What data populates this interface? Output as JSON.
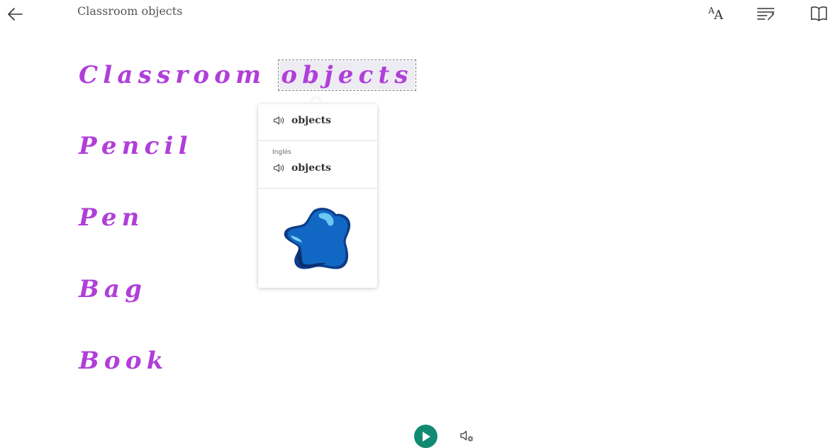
{
  "header": {
    "title": "Classroom objects",
    "icons": {
      "back": "arrow-left-icon",
      "text_preferences": "text-size-icon",
      "grammar_options": "grammar-options-icon",
      "reading_preferences": "book-icon"
    }
  },
  "content": {
    "line1_word1": "Classroom",
    "line1_word2": "objects",
    "line2": "Pencil",
    "line3": "Pen",
    "line4": "Bag",
    "line5": "Book"
  },
  "dictionary_popup": {
    "word": "objects",
    "language_label": "Inglés",
    "translated_word": "objects",
    "picture": "blue-blob-picture"
  },
  "footer": {
    "play": "play-icon",
    "voice_settings": "voice-settings-icon"
  },
  "colors": {
    "word_text": "#b03fd9",
    "play_button": "#128a72",
    "header_text": "#555555"
  }
}
